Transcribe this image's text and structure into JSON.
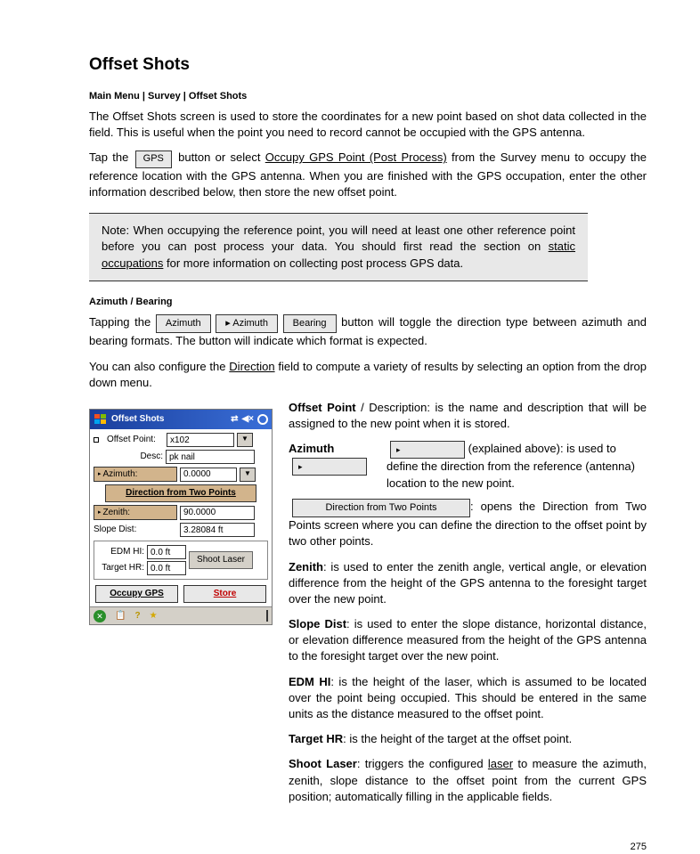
{
  "heading": "Offset Shots",
  "overview_label": "Main Menu | Survey | Offset Shots",
  "overview_para": "The Offset Shots screen is used to store the coordinates for a new point based on shot data collected in the field. This is useful when the point you need to record cannot be occupied with the GPS antenna.",
  "para2_before": "Tap the ",
  "gps_btn_lbl": "GPS",
  "para2_mid": " button or select ",
  "link_text": "Occupy GPS Point (Post Process)",
  "para2_after": " from the Survey menu to occupy the reference location with the GPS antenna. When you are finished with the GPS occupation, enter the other information described below, then store the new offset point.",
  "note_text_a": "Note: When occupying the reference point, you will need at least one other reference point before you can post process your data. You should first read the section on ",
  "note_link": "static occupations",
  "note_text_b": " for more information on collecting post process GPS data.",
  "azimuth_label": "Azimuth / Bearing",
  "azimuth_para_before": "Tapping the ",
  "azimuth_btn1": "Azimuth",
  "azimuth_btn2": "▸ Azimuth",
  "azimuth_btn3": "Bearing",
  "azimuth_para_after": " button will toggle the direction type between azimuth and bearing formats. The button will indicate which format is expected.",
  "azimuth_para2_before": "You can also configure the ",
  "azimuth_link": "Direction",
  "azimuth_para2_after": " field to compute a variety of results by selecting an option from the drop down menu.",
  "pda": {
    "title": "Offset Shots",
    "offset_point_lbl": "Offset Point:",
    "offset_point_val": "x102",
    "desc_lbl": "Desc:",
    "desc_val": "pk nail",
    "azimuth_btn": "Azimuth:",
    "azimuth_val": "0.0000",
    "dir_btn": "Direction from Two Points",
    "zenith_btn": "Zenith:",
    "zenith_val": "90.0000",
    "slope_lbl": "Slope Dist:",
    "slope_val": "3.28084 ft",
    "edm_lbl": "EDM HI:",
    "edm_val": "0.0 ft",
    "target_lbl": "Target HR:",
    "target_val": "0.0 ft",
    "shoot_btn": "Shoot Laser",
    "occupy_btn": "Occupy GPS",
    "store_btn": "Store"
  },
  "right_col": {
    "offset_pt_lbl": "Offset Point",
    "offset_desc_lbl": " / Description",
    "offset_pt_text": ": is the name and description that will be assigned to the new point when it is stored.",
    "azimuth_lbl": "Azimuth",
    "azimuth_text": " (explained above): is used to define the direction from the reference (antenna) location to the new point.",
    "tri_btn": "▸",
    "dir_btn_lbl": "Direction from Two Points",
    "dir_btn_text": ": opens the Direction from Two Points screen where you can define the direction to the offset point by two other points.",
    "zenith_lbl": "Zenith",
    "zenith_text": ": is used to enter the zenith angle, vertical angle, or elevation difference from the height of the GPS antenna to the foresight target over the new point.",
    "slope_lbl": "Slope Dist",
    "slope_text": ": is used to enter the slope distance, horizontal distance, or elevation difference measured from the height of the GPS antenna to the foresight target over the new point.",
    "edm_lbl": "EDM HI",
    "edm_text": ": is the height of the laser, which is assumed to be located over the point being occupied. This should be entered in the same units as the distance measured to the offset point.",
    "target_lbl": "Target HR",
    "target_text": ": is the height of the target at the offset point.",
    "shoot_lbl": "Shoot Laser",
    "shoot_text": ": triggers the configured ",
    "shoot_link": "laser",
    "shoot_text2": " to measure the azimuth, zenith, slope distance to the offset point from the current GPS position; automatically filling in the applicable fields."
  },
  "page_number": "275"
}
